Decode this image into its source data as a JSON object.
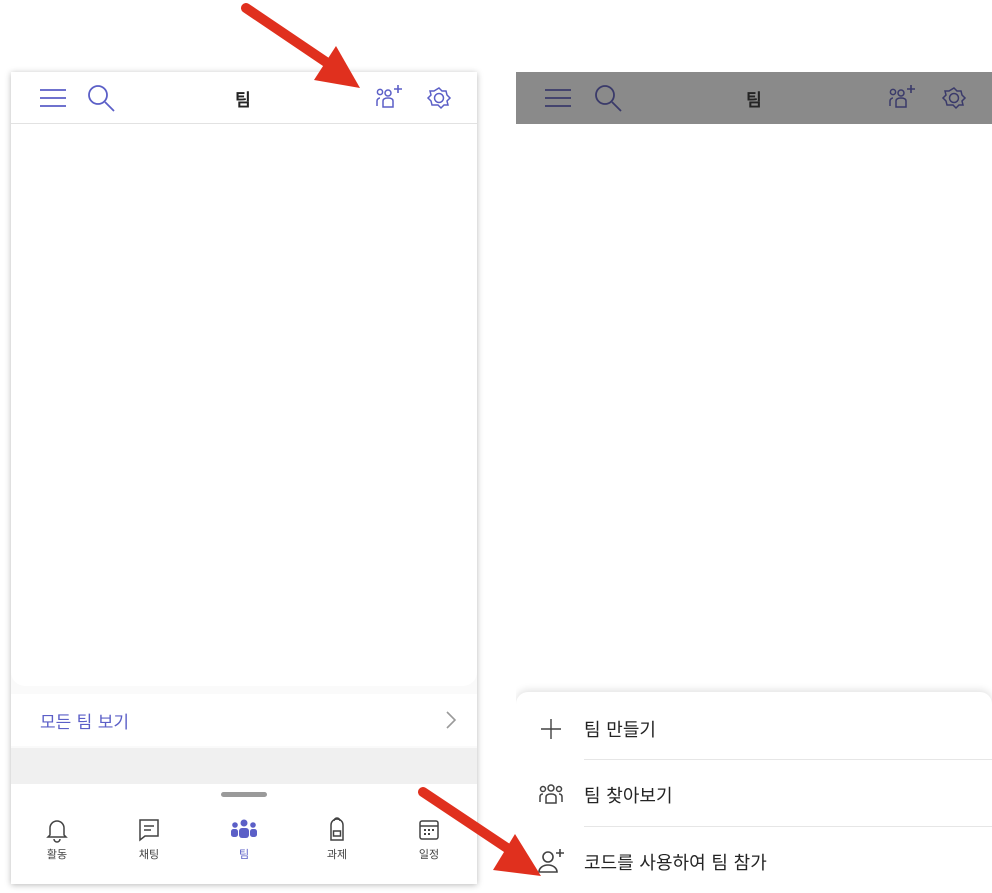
{
  "left_screen": {
    "header": {
      "title": "팀",
      "icons": [
        "hamburger-menu-icon",
        "search-icon",
        "add-team-icon",
        "settings-icon"
      ]
    },
    "see_all_teams": "모든 팀 보기",
    "tabs": [
      {
        "label": "활동",
        "icon": "bell-icon",
        "active": false
      },
      {
        "label": "채팅",
        "icon": "chat-icon",
        "active": false
      },
      {
        "label": "팀",
        "icon": "teams-icon",
        "active": true
      },
      {
        "label": "과제",
        "icon": "backpack-icon",
        "active": false
      },
      {
        "label": "일정",
        "icon": "calendar-icon",
        "active": false
      }
    ]
  },
  "right_screen": {
    "header": {
      "title": "팀"
    },
    "menu": [
      {
        "label": "팀 만들기",
        "icon": "plus-icon"
      },
      {
        "label": "팀 찾아보기",
        "icon": "browse-teams-icon"
      },
      {
        "label": "코드를 사용하여 팀 참가",
        "icon": "join-with-code-icon"
      }
    ]
  },
  "colors": {
    "accent": "#5b5fc7",
    "annotation_arrow": "#e0301e",
    "dim_header": "#8a8a8a"
  }
}
